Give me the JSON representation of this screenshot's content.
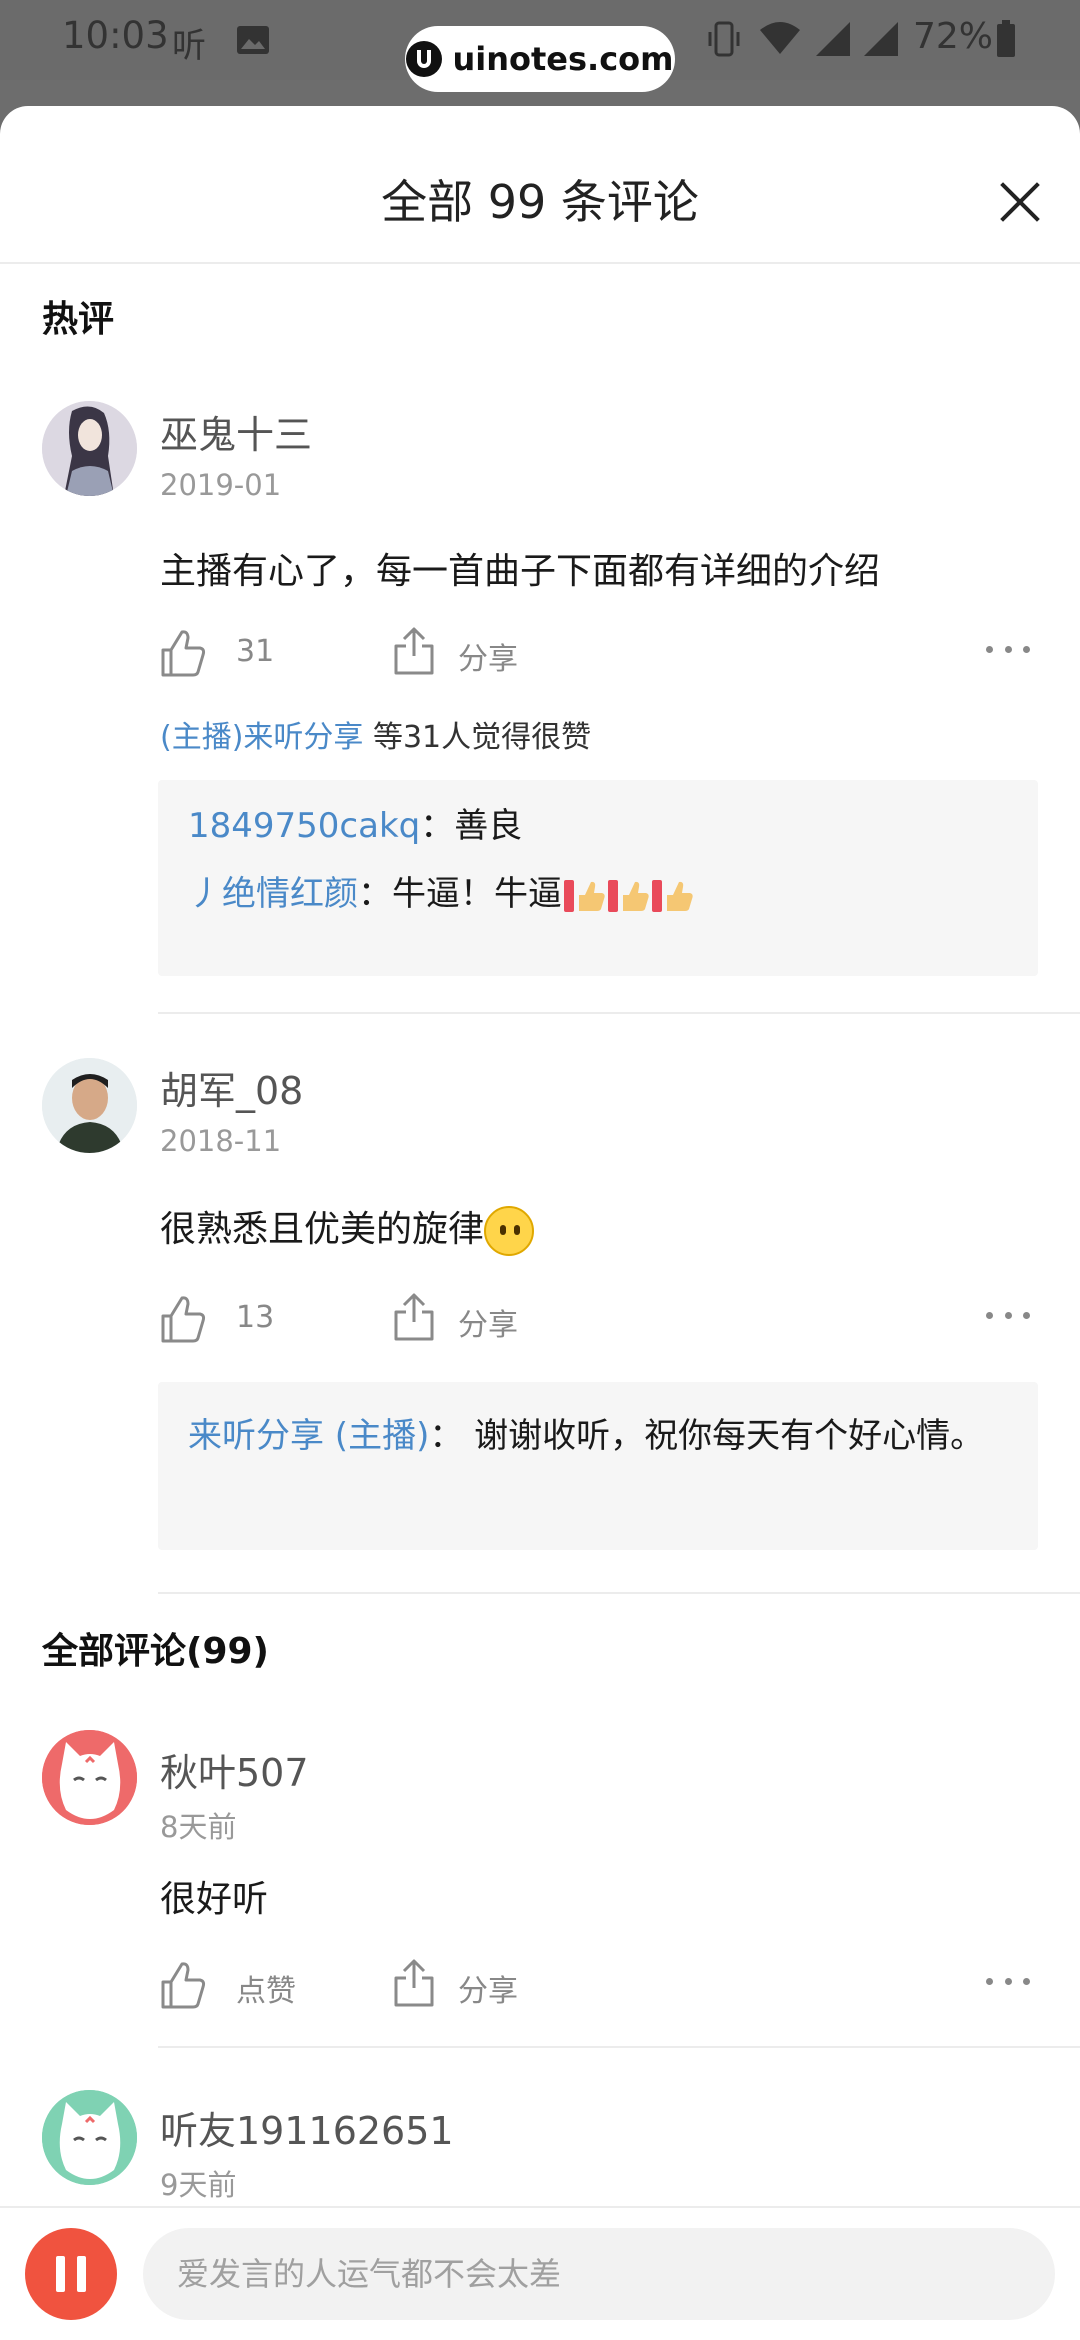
{
  "status_bar": {
    "time": "10:03",
    "app_indicator": "听",
    "battery": "72%"
  },
  "watermark": {
    "text": "uinotes.com"
  },
  "sheet": {
    "title": "全部 99 条评论"
  },
  "hot_section": {
    "title": "热评"
  },
  "all_section": {
    "title": "全部评论(99)"
  },
  "hot_comments": [
    {
      "user": "巫鬼十三",
      "date": "2019-01",
      "text": "主播有心了，每一首曲子下面都有详细的介绍",
      "likes": "31",
      "share": "分享",
      "liked_by_link": "(主播)来听分享",
      "liked_by_rest": " 等31人觉得很赞",
      "replies": [
        {
          "user": "1849750cakq",
          "sep": "：",
          "text": "善良"
        },
        {
          "user": "丿绝情红颜",
          "sep": "：",
          "text": "牛逼！牛逼"
        }
      ]
    },
    {
      "user": "胡军_08",
      "date": "2018-11",
      "text": "很熟悉且优美的旋律",
      "likes": "13",
      "share": "分享",
      "replies": [
        {
          "user": "来听分享 (主播)",
          "sep": "： ",
          "text": "谢谢收听，祝你每天有个好心情。"
        }
      ]
    }
  ],
  "all_comments": [
    {
      "user": "秋叶507",
      "date": "8天前",
      "text": "很好听",
      "likes": "点赞",
      "share": "分享"
    },
    {
      "user": "听友191162651",
      "date": "9天前"
    }
  ],
  "bottom_bar": {
    "input_placeholder": "爱发言的人运气都不会太差"
  },
  "colors": {
    "accent": "#f0533f",
    "link": "#4a89c8"
  }
}
